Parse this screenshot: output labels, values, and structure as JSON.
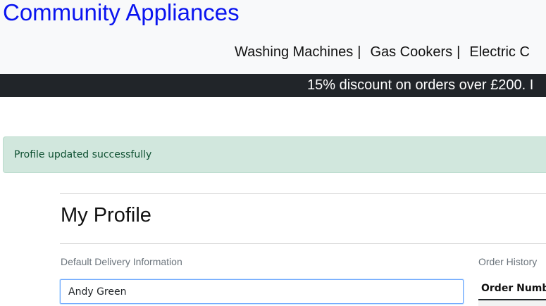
{
  "header": {
    "brand": "Community Appliances",
    "nav": [
      {
        "label": "Washing Machines",
        "sep": "|"
      },
      {
        "label": "Gas Cookers",
        "sep": "|"
      },
      {
        "label": "Electric C",
        "sep": ""
      }
    ]
  },
  "promo": {
    "text": "15% discount on orders over £200. I"
  },
  "alert": {
    "message": "Profile updated successfully",
    "color": "#0f5132",
    "background": "#d1e7dd"
  },
  "profile": {
    "title": "My Profile",
    "delivery_label": "Default Delivery Information",
    "orders_label": "Order History",
    "full_name_value": "Andy Green",
    "orders_table": {
      "headers": [
        "Order Number"
      ]
    }
  },
  "colors": {
    "brand": "#0a14f0",
    "promo_bar": "#212529"
  }
}
